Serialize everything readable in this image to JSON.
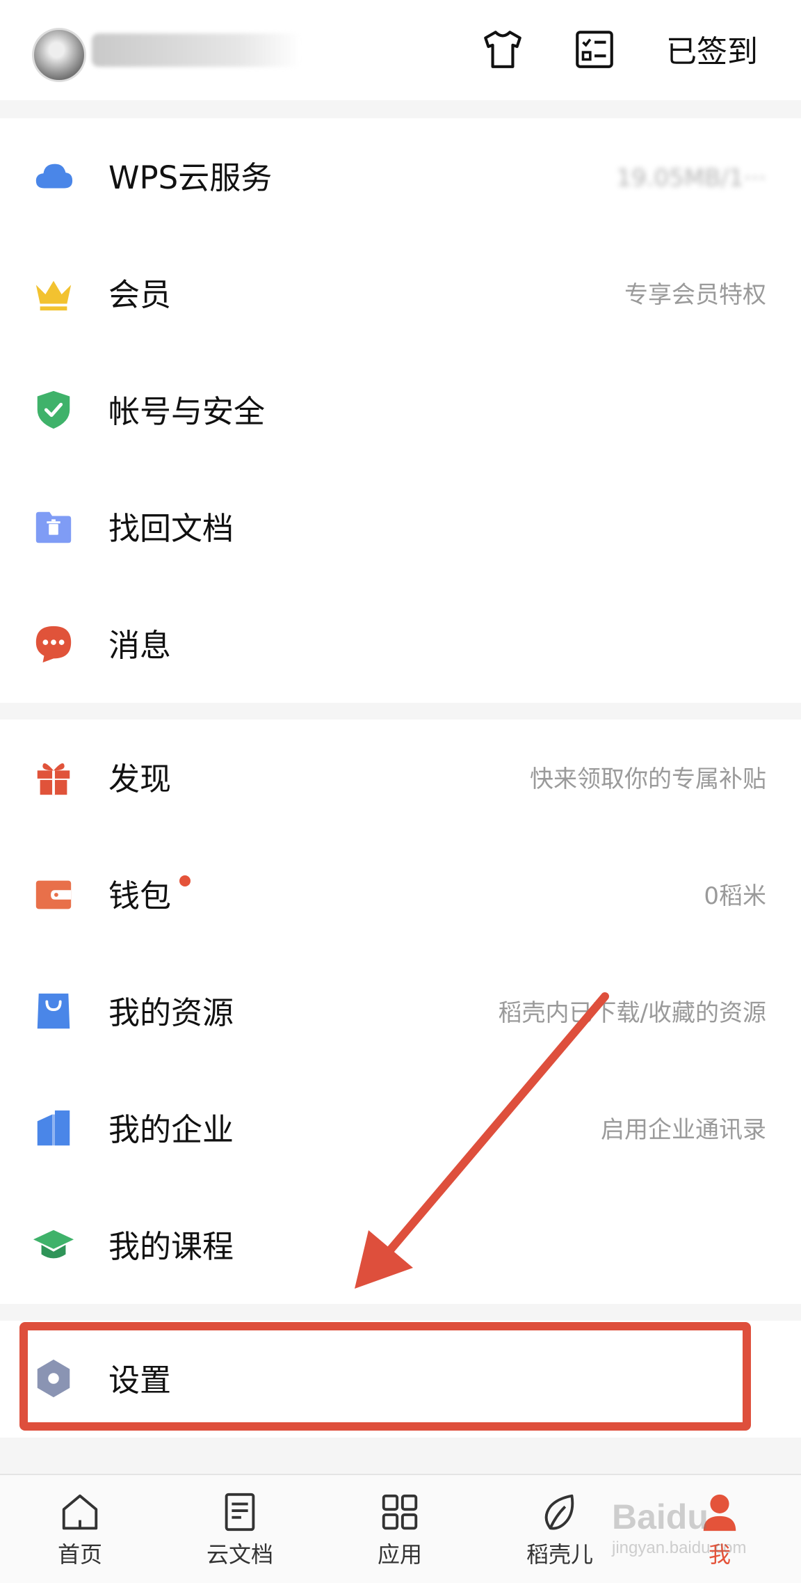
{
  "header": {
    "username": "······",
    "signin_label": "已签到",
    "icons": [
      "tshirt-icon",
      "checklist-icon"
    ]
  },
  "group1": [
    {
      "label": "WPS云服务",
      "value": "19.05MB/1···",
      "icon": "cloud-icon",
      "color": "#4a86e8"
    },
    {
      "label": "会员",
      "value": "专享会员特权",
      "icon": "crown-icon",
      "color": "#f2c230"
    },
    {
      "label": "帐号与安全",
      "value": "",
      "icon": "shield-icon",
      "color": "#3fb26a"
    },
    {
      "label": "找回文档",
      "value": "",
      "icon": "folder-trash-icon",
      "color": "#6c8cf0"
    },
    {
      "label": "消息",
      "value": "",
      "icon": "chat-bubble-icon",
      "color": "#e0533a"
    }
  ],
  "group2": [
    {
      "label": "发现",
      "value": "快来领取你的专属补贴",
      "icon": "gift-icon",
      "color": "#e0533a"
    },
    {
      "label": "钱包",
      "value": "0稻米",
      "icon": "wallet-icon",
      "color": "#e8704a"
    },
    {
      "label": "我的资源",
      "value": "稻壳内已下载/收藏的资源",
      "icon": "shopping-bag-icon",
      "color": "#4a86e8"
    },
    {
      "label": "我的企业",
      "value": "启用企业通讯录",
      "icon": "building-icon",
      "color": "#4a86e8"
    },
    {
      "label": "我的课程",
      "value": "",
      "icon": "graduation-cap-icon",
      "color": "#3fb26a"
    }
  ],
  "group3": [
    {
      "label": "设置",
      "value": "",
      "icon": "settings-hexagon-icon",
      "color": "#8a94b3"
    }
  ],
  "bottom_nav": [
    {
      "label": "首页",
      "icon": "home-icon",
      "active": false
    },
    {
      "label": "云文档",
      "icon": "document-icon",
      "active": false
    },
    {
      "label": "应用",
      "icon": "apps-grid-icon",
      "active": false
    },
    {
      "label": "稻壳儿",
      "icon": "leaf-icon",
      "active": false
    },
    {
      "label": "我",
      "icon": "profile-icon",
      "active": true
    }
  ],
  "watermark": {
    "line1": "Baidu",
    "line2": "jingyan.baidu.com"
  },
  "colors": {
    "accent": "#e4533a",
    "annotation": "#de4f3c"
  }
}
